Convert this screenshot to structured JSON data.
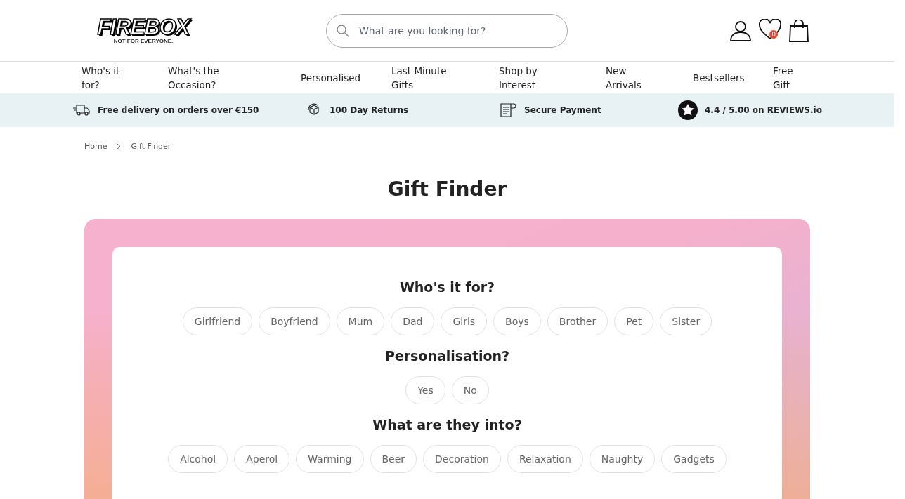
{
  "logo": {
    "name": "FIREBOX",
    "tagline": "NOT FOR EVERYONE."
  },
  "search": {
    "placeholder": "What are you looking for?"
  },
  "wishlist_count": "0",
  "nav": [
    {
      "label": "Who's it for?"
    },
    {
      "label": "What's the Occasion?"
    },
    {
      "label": "Personalised"
    },
    {
      "label": "Last Minute Gifts"
    },
    {
      "label": "Shop by Interest"
    },
    {
      "label": "New Arrivals"
    },
    {
      "label": "Bestsellers"
    },
    {
      "label": "Free Gift"
    }
  ],
  "benefits": [
    {
      "kind": "truck",
      "text": "Free delivery on orders over €150"
    },
    {
      "kind": "box",
      "text": "100 Day Returns"
    },
    {
      "kind": "receipt",
      "text": "Secure Payment"
    },
    {
      "kind": "star",
      "text": "4.4 / 5.00 on REVIEWS.io"
    }
  ],
  "breadcrumb": [
    "Home",
    "Gift Finder"
  ],
  "title": "Gift Finder",
  "questions": [
    {
      "title": "Who's it for?",
      "options": [
        {
          "label": "Girlfriend",
          "selected": false
        },
        {
          "label": "Boyfriend",
          "selected": false
        },
        {
          "label": "Mum",
          "selected": false
        },
        {
          "label": "Dad",
          "selected": false
        },
        {
          "label": "Girls",
          "selected": false
        },
        {
          "label": "Boys",
          "selected": false
        },
        {
          "label": "Brother",
          "selected": false
        },
        {
          "label": "Pet",
          "selected": false
        },
        {
          "label": "Sister",
          "selected": false
        }
      ]
    },
    {
      "title": "Personalisation?",
      "options": [
        {
          "label": "Yes",
          "selected": false
        },
        {
          "label": "No",
          "selected": false
        }
      ]
    },
    {
      "title": "What are they into?",
      "options": [
        {
          "label": "Alcohol",
          "selected": false
        },
        {
          "label": "Aperol",
          "selected": false
        },
        {
          "label": "Warming",
          "selected": false
        },
        {
          "label": "Beer",
          "selected": false
        },
        {
          "label": "Decoration",
          "selected": false
        },
        {
          "label": "Relaxation",
          "selected": false
        },
        {
          "label": "Naughty",
          "selected": false
        },
        {
          "label": "Gadgets",
          "selected": false
        }
      ]
    }
  ]
}
